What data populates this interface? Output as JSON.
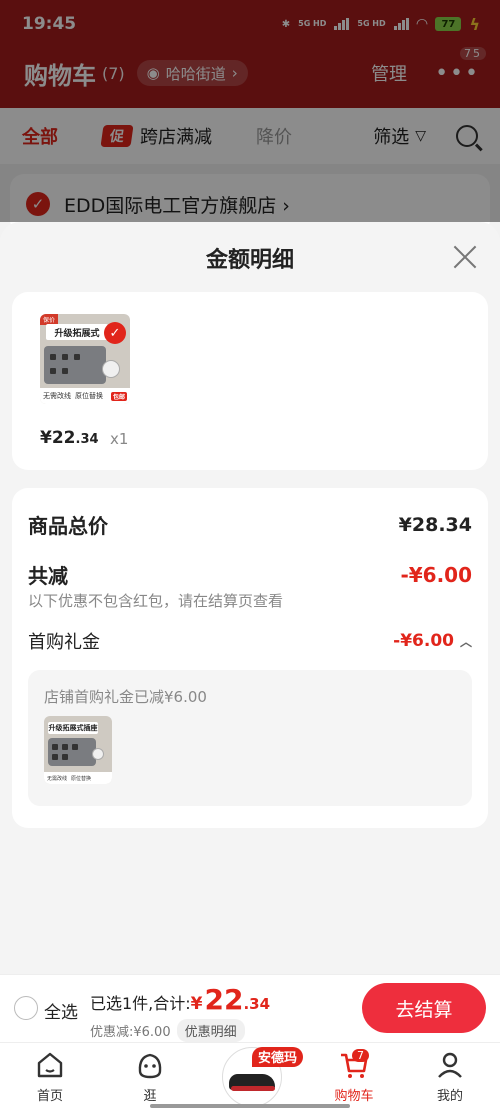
{
  "status_bar": {
    "time": "19:45",
    "network1": "5G HD",
    "network2": "5G HD",
    "battery": "77"
  },
  "header": {
    "title": "购物车",
    "count": "(7)",
    "address": "哈哈街道",
    "manage": "管理",
    "more_badge": "75"
  },
  "filter": {
    "all": "全部",
    "promo_tag": "促",
    "promo": "跨店满减",
    "price_drop": "降价",
    "filter": "筛选"
  },
  "store": {
    "name": "EDD国际电工官方旗舰店 ›"
  },
  "sheet": {
    "title": "金额明细",
    "product": {
      "banner": "升级拓展式",
      "top_tag": "保价",
      "foot_left": "无需改线",
      "foot_mid": "原位替换",
      "foot_tag": "包邮",
      "price_yen": "¥22",
      "price_dec": ".34",
      "qty": "x1"
    },
    "total_label": "商品总价",
    "total_value": "¥28.34",
    "reduce_label": "共减",
    "reduce_value": "-¥6.00",
    "hint": "以下优惠不包含红包，请在结算页查看",
    "gift_label": "首购礼金",
    "gift_value": "-¥6.00",
    "inner_text": "店铺首购礼金已减¥6.00",
    "inner_banner": "升级拓展式插座"
  },
  "checkout": {
    "select_all": "全选",
    "selected": "已选1件,合计:",
    "yen": "¥",
    "amount_int": "22",
    "amount_dec": ".34",
    "discount": "优惠减:¥6.00",
    "detail_chip": "优惠明细",
    "pay": "去结算"
  },
  "tabs": {
    "home": "首页",
    "browse": "逛",
    "promo_badge": "安德玛",
    "cart": "购物车",
    "cart_badge": "7",
    "me": "我的"
  },
  "colors": {
    "header_red": "#a51d1d",
    "accent": "#e1251b",
    "pay_button": "#ee2e3d"
  }
}
